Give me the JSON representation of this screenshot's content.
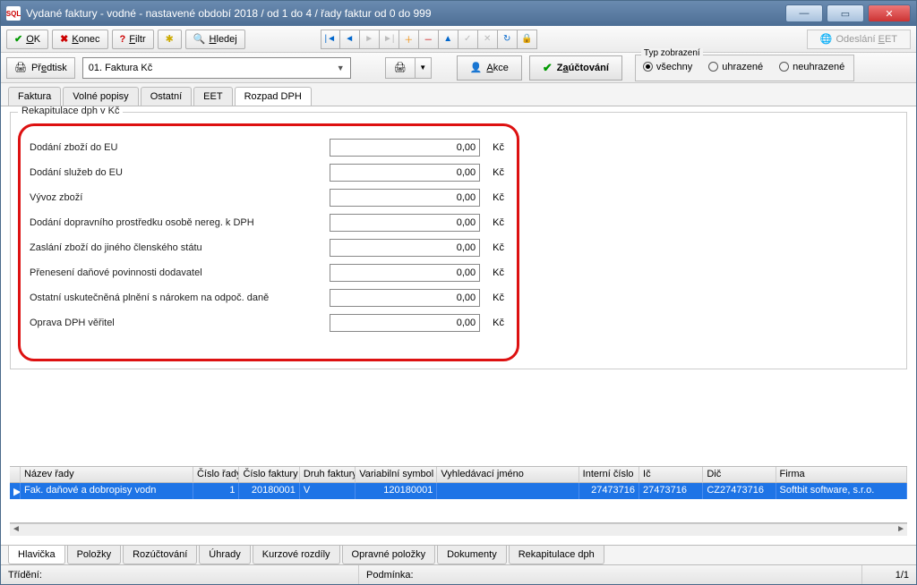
{
  "window": {
    "title": "Vydané faktury - vodné - nastavené období 2018 / od 1 do 4 / řady faktur od 0 do 999"
  },
  "toolbar1": {
    "ok": "OK",
    "konec": "Konec",
    "filtr": "Filtr",
    "hledej": "Hledej",
    "eet": "Odeslání EET"
  },
  "toolbar2": {
    "predtisk": "Předtisk",
    "combo_value": "01. Faktura Kč",
    "akce": "Akce",
    "zauctovani": "Zaúčtování",
    "typ_legend": "Typ zobrazení",
    "typ_vsechny": "všechny",
    "typ_uhrazene": "uhrazené",
    "typ_neuhrazene": "neuhrazené"
  },
  "tabs_upper": {
    "faktura": "Faktura",
    "volne_popisy": "Volné popisy",
    "ostatni": "Ostatní",
    "eet": "EET",
    "rozpad_dph": "Rozpad DPH"
  },
  "rekap": {
    "legend": "Rekapitulace dph v Kč",
    "unit": "Kč",
    "rows": [
      {
        "label": "Dodání zboží do EU",
        "value": "0,00"
      },
      {
        "label": "Dodání služeb do EU",
        "value": "0,00"
      },
      {
        "label": "Vývoz zboží",
        "value": "0,00"
      },
      {
        "label": "Dodání dopravního prostředku osobě nereg. k DPH",
        "value": "0,00"
      },
      {
        "label": "Zaslání zboží do jiného členského státu",
        "value": "0,00"
      },
      {
        "label": "Přenesení daňové povinnosti dodavatel",
        "value": "0,00"
      },
      {
        "label": "Ostatní uskutečněná plnění  s nárokem  na odpoč. daně",
        "value": "0,00"
      },
      {
        "label": "Oprava DPH věřitel",
        "value": "0,00"
      }
    ]
  },
  "grid": {
    "headers": [
      "Název řady",
      "Číslo řady",
      "Číslo faktury",
      "Druh faktury",
      "Variabilní symbol",
      "Vyhledávací jméno",
      "Interní číslo",
      "Ič",
      "Dič",
      "Firma"
    ],
    "widths": [
      195,
      52,
      68,
      63,
      92,
      160,
      68,
      72,
      82,
      148
    ],
    "row": {
      "nazev_rady": "Fak. daňové a dobropisy vodn",
      "cislo_rady": "1",
      "cislo_faktury": "20180001",
      "druh_faktury": "V",
      "variabilni_symbol": "120180001",
      "vyhledavaci_jmeno": "",
      "interni_cislo": "27473716",
      "ic": "27473716",
      "dic": "CZ27473716",
      "firma": "Softbit software, s.r.o."
    }
  },
  "tabs_lower": {
    "hlavicka": "Hlavička",
    "polozky": "Položky",
    "rozuctovani": "Rozúčtování",
    "uhrady": "Úhrady",
    "kurzove_rozdily": "Kurzové rozdíly",
    "opravne_polozky": "Opravné položky",
    "dokumenty": "Dokumenty",
    "rekapitulace_dph": "Rekapitulace dph"
  },
  "statusbar": {
    "trideni": "Třídění:",
    "podminka": "Podmínka:",
    "counter": "1/1"
  }
}
